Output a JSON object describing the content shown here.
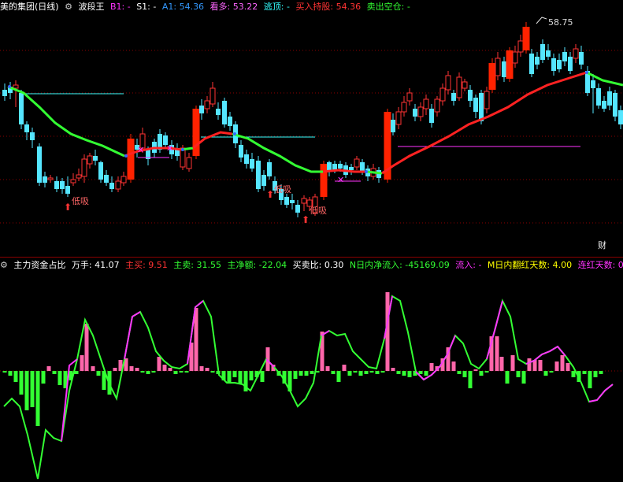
{
  "colors": {
    "bg": "#000000",
    "grid": "#8b0000",
    "up": "#ff3333",
    "down": "#55e6ff",
    "big_up": "#ff2a00",
    "ma_green": "#33ff33",
    "ma_red": "#ff2222",
    "pink": "#ff66cc",
    "cyan": "#33ffff",
    "magenta": "#ff33ff",
    "yellow": "#ffff00",
    "white": "#dddddd"
  },
  "top_header": {
    "title": "美的集团(日线)",
    "indicator_icon": "gear-icon",
    "indicator_name": "波段王",
    "b1": "B1: -",
    "s1": "S1: -",
    "a1": "A1: 54.36",
    "kanduo": "看多: 53.22",
    "taoding": "逃顶: -",
    "mairu": "买入持股: 54.36",
    "maichu": "卖出空仓: -"
  },
  "price_labels": {
    "high": "58.75",
    "dips": [
      "低吸",
      "低吸",
      "低吸"
    ]
  },
  "finance_mark": "财",
  "bottom_header": {
    "indicator_icon": "gear-icon",
    "name": "主力资金占比",
    "wanshou": "万手: 41.07",
    "zhumai": "主买: 9.51",
    "zhumai2": "主卖: 31.55",
    "jinge": "主净额: -22.04",
    "maimaibi": "买卖比: 0.30",
    "ndnjl": "N日内净流入: -45169.09",
    "liuru": "流入: -",
    "mrfh": "M日内翻红天数: 4.00",
    "lhts": "连红天数: 0"
  }
}
